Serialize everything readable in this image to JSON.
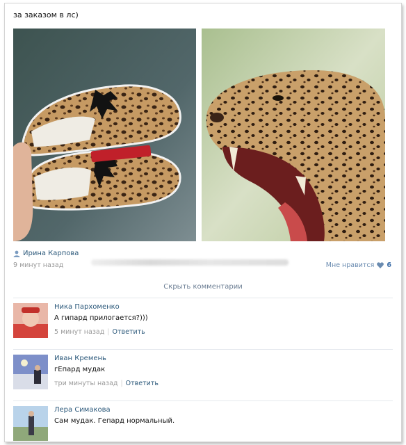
{
  "post": {
    "text": "за заказом в лс)",
    "author": "Ирина Карпова",
    "time": "9 минут назад",
    "like_label": "Мне нравится",
    "like_count": "6",
    "images": [
      "sneakers-photo",
      "leopard-photo"
    ]
  },
  "comments_toggle": "Скрыть комментарии",
  "comments": [
    {
      "name": "Ника Пархоменко",
      "text": "А гипард прилогается?)))",
      "time": "5 минут назад",
      "reply": "Ответить"
    },
    {
      "name": "Иван Кремень",
      "text": "гЕпард мудак",
      "time": "три минуты назад",
      "reply": "Ответить"
    },
    {
      "name": "Лера Симакова",
      "text": "Сам мудак. Гепард нормальный."
    }
  ],
  "colors": {
    "link": "#2b587a",
    "muted": "#999999",
    "like_accent": "#3d6ea8"
  },
  "icons": [
    "user-icon",
    "heart-icon"
  ]
}
